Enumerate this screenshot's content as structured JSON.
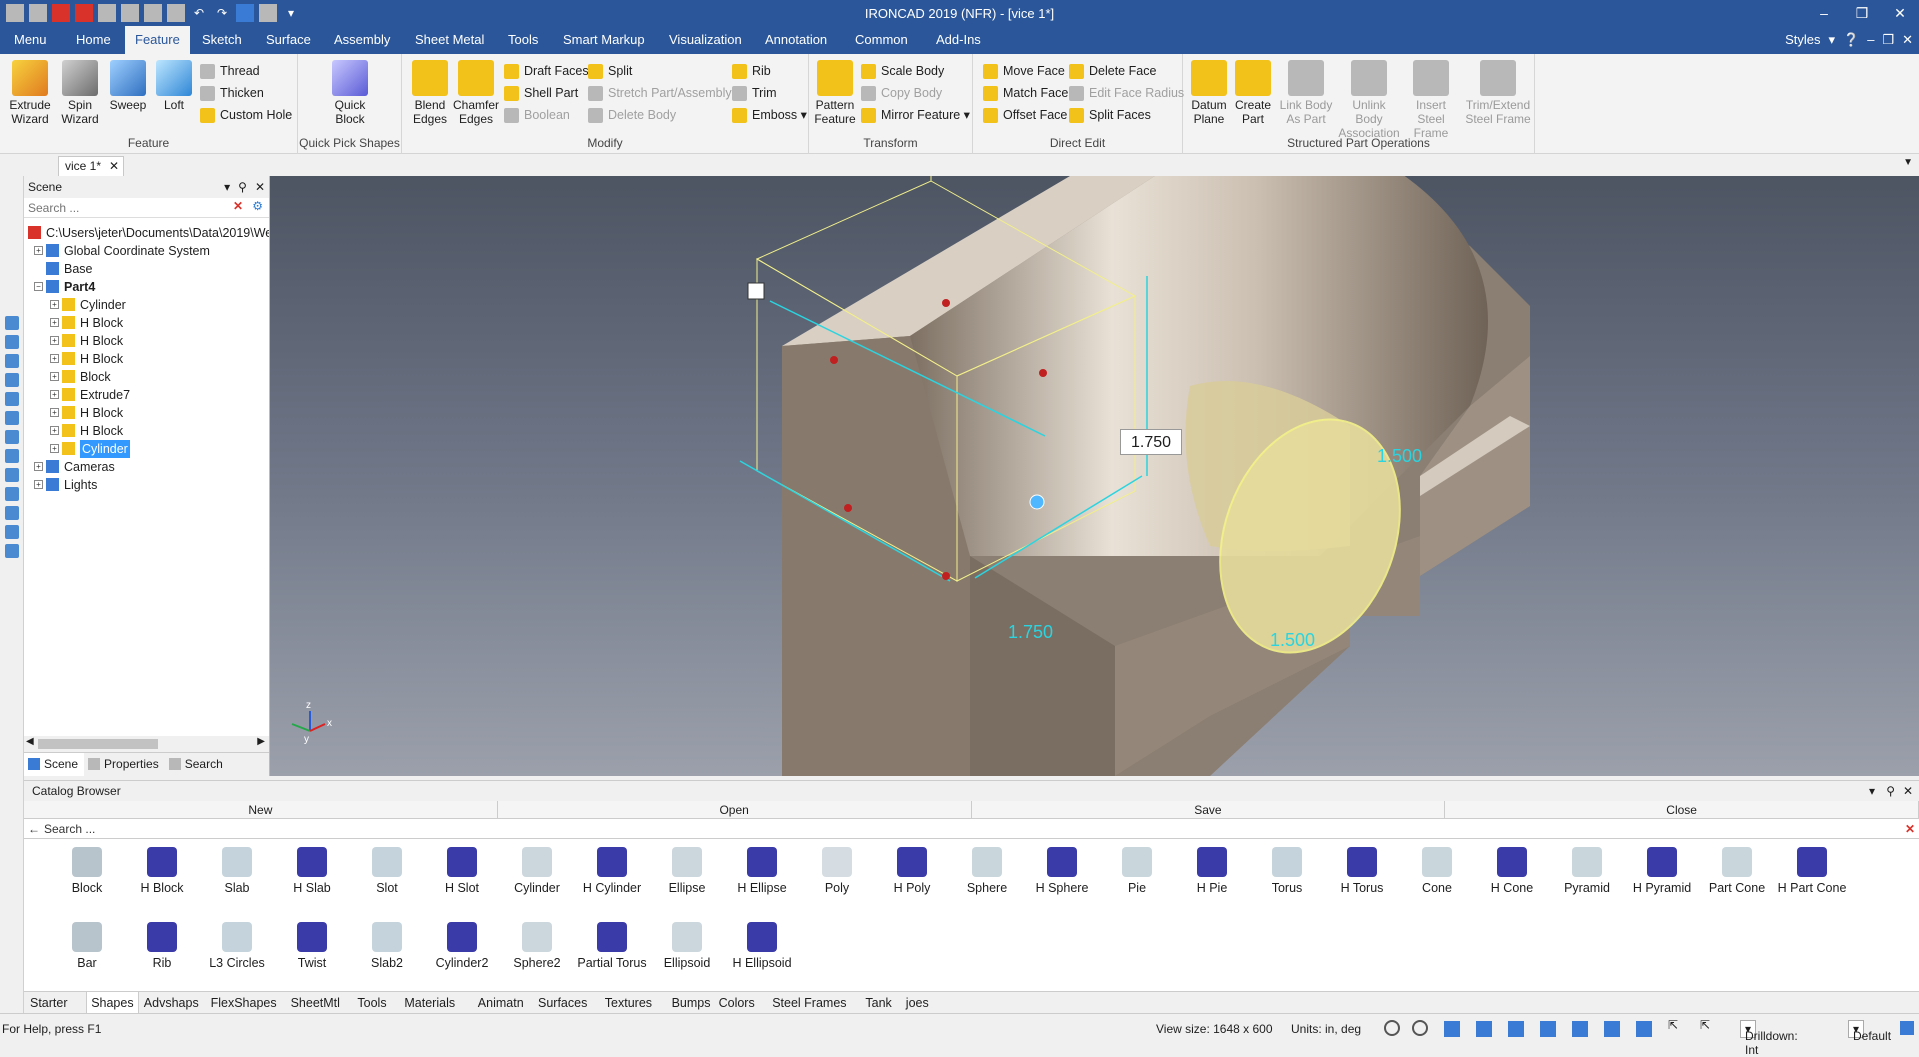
{
  "window": {
    "title": "IRONCAD 2019 (NFR) - [vice 1*]",
    "controls": [
      "–",
      "❒",
      "✕"
    ]
  },
  "menubar": {
    "tabs": [
      "Menu",
      "Home",
      "Feature",
      "Sketch",
      "Surface",
      "Assembly",
      "Sheet Metal",
      "Tools",
      "Smart Markup",
      "Visualization",
      "Annotation",
      "Common",
      "Add-Ins"
    ],
    "active_tab": "Feature",
    "styles_label": "Styles"
  },
  "ribbon": {
    "feature_group": {
      "label": "Feature",
      "extrude": "Extrude Wizard",
      "spin": "Spin Wizard",
      "sweep": "Sweep",
      "loft": "Loft",
      "thread": "Thread",
      "thicken": "Thicken",
      "custom_hole": "Custom Hole"
    },
    "quick_pick": {
      "label": "Quick Pick Shapes",
      "quick_block": "Quick Block"
    },
    "modify": {
      "label": "Modify",
      "blend": "Blend Edges",
      "chamfer": "Chamfer Edges",
      "draft_faces": "Draft Faces",
      "shell_part": "Shell Part",
      "boolean": "Boolean",
      "split": "Split",
      "stretch": "Stretch Part/Assembly",
      "delete_body": "Delete Body",
      "rib": "Rib",
      "trim": "Trim",
      "emboss": "Emboss"
    },
    "transform": {
      "label": "Transform",
      "pattern": "Pattern Feature",
      "scale_body": "Scale Body",
      "copy_body": "Copy Body",
      "mirror_feature": "Mirror Feature"
    },
    "direct_edit": {
      "label": "Direct Edit",
      "move_face": "Move Face",
      "match_face": "Match Face",
      "offset_face": "Offset Face",
      "delete_face": "Delete Face",
      "edit_face_radius": "Edit Face Radius",
      "split_faces": "Split Faces"
    },
    "structured": {
      "label": "Structured Part Operations",
      "datum_plane": "Datum Plane",
      "create_part": "Create Part",
      "link_body": "Link Body As Part",
      "unlink_body": "Unlink Body Association",
      "insert_steel": "Insert Steel Frame",
      "trim_steel": "Trim/Extend Steel Frame"
    }
  },
  "document_tab": "vice 1*",
  "scene": {
    "title": "Scene",
    "search_placeholder": "Search ...",
    "root": "C:\\Users\\jeter\\Documents\\Data\\2019\\We",
    "items": [
      {
        "label": "Global Coordinate System",
        "level": 1,
        "expander": "+"
      },
      {
        "label": "Base",
        "level": 1,
        "expander": ""
      },
      {
        "label": "Part4",
        "level": 1,
        "expander": "−"
      },
      {
        "label": "Cylinder",
        "level": 2,
        "expander": "+"
      },
      {
        "label": "H Block",
        "level": 2,
        "expander": "+"
      },
      {
        "label": "H Block",
        "level": 2,
        "expander": "+"
      },
      {
        "label": "H Block",
        "level": 2,
        "expander": "+"
      },
      {
        "label": "Block",
        "level": 2,
        "expander": "+"
      },
      {
        "label": "Extrude7",
        "level": 2,
        "expander": "+"
      },
      {
        "label": "H Block",
        "level": 2,
        "expander": "+"
      },
      {
        "label": "H Block",
        "level": 2,
        "expander": "+"
      },
      {
        "label": "Cylinder",
        "level": 2,
        "expander": "+",
        "selected": true
      },
      {
        "label": "Cameras",
        "level": 1,
        "expander": "+"
      },
      {
        "label": "Lights",
        "level": 1,
        "expander": "+"
      }
    ],
    "tabs": [
      "Scene",
      "Properties",
      "Search"
    ]
  },
  "viewport": {
    "dimension_box": "1.750",
    "dim_height": "1.500",
    "dim_width": "1.500",
    "dim_depth": "1.750",
    "axis_labels": [
      "z",
      "x",
      "y"
    ]
  },
  "catalog": {
    "title": "Catalog Browser",
    "buttons": [
      "New",
      "Open",
      "Save",
      "Close"
    ],
    "search_placeholder": "Search ...",
    "shapes_row1": [
      "Block",
      "H Block",
      "Slab",
      "H Slab",
      "Slot",
      "H Slot",
      "Cylinder",
      "H Cylinder",
      "Ellipse",
      "H Ellipse",
      "Poly",
      "H Poly",
      "Sphere",
      "H Sphere",
      "Pie",
      "H Pie",
      "Torus",
      "H Torus",
      "Cone",
      "H Cone",
      "Pyramid",
      "H Pyramid",
      "Part Cone",
      "H Part Cone"
    ],
    "shapes_row2": [
      "Bar",
      "Rib",
      "L3 Circles",
      "Twist",
      "Slab2",
      "Cylinder2",
      "Sphere2",
      "Partial Torus",
      "Ellipsoid",
      "H Ellipsoid"
    ],
    "tabs": [
      "Starter",
      "Shapes",
      "Advshaps",
      "FlexShapes",
      "SheetMtl",
      "Tools",
      "Materials",
      "Animatn",
      "Surfaces",
      "Textures",
      "Bumps",
      "Colors",
      "Steel Frames",
      "Tank",
      "joes"
    ],
    "active_tab": "Shapes"
  },
  "status": {
    "help": "For Help, press F1",
    "view_size": "View size: 1648 x 600",
    "units": "Units: in, deg",
    "drilldown": "Drilldown: Int",
    "style": "Default"
  }
}
